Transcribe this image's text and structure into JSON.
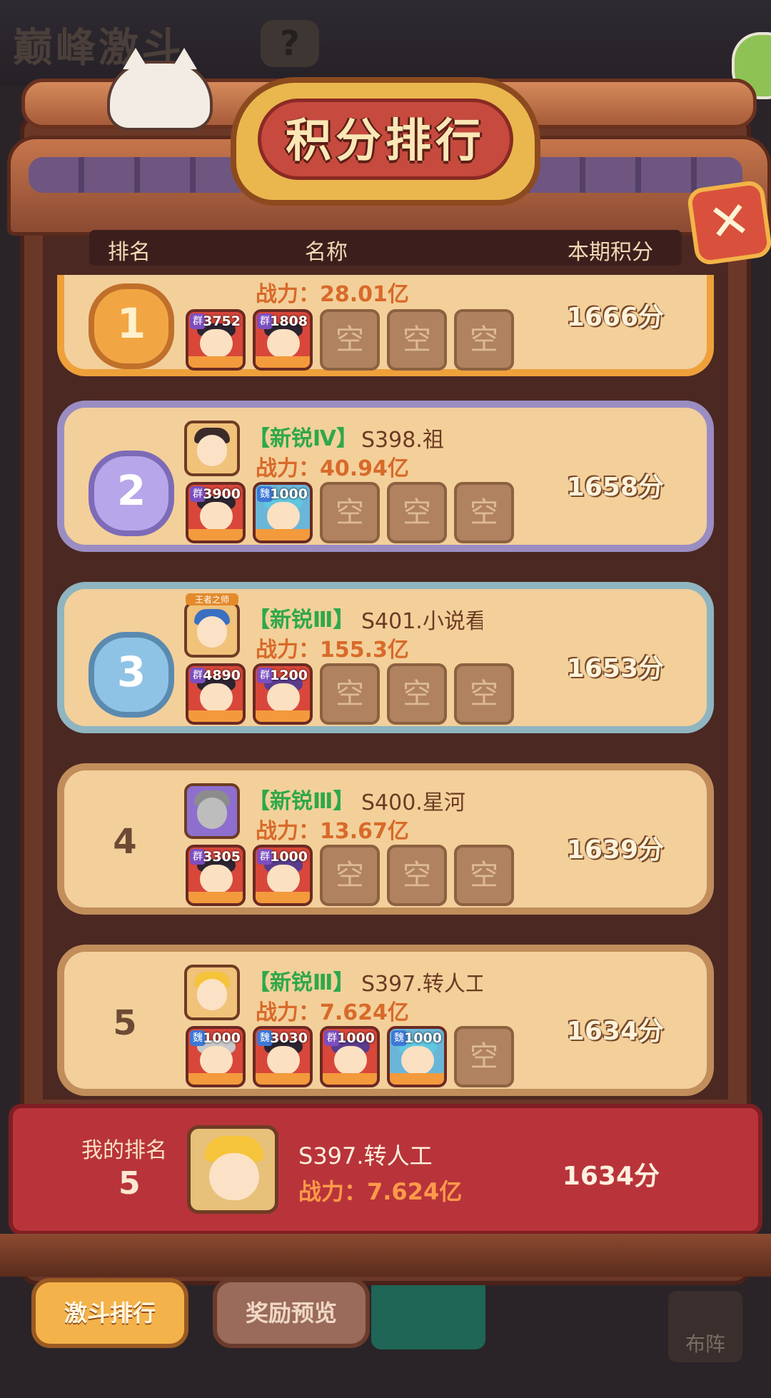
{
  "background": {
    "title": "巅峰激斗",
    "help_glyph": "?",
    "side_button_label": "布阵"
  },
  "panel": {
    "title": "积分排行",
    "close_glyph": "✕"
  },
  "header": {
    "rank": "排名",
    "name": "名称",
    "score": "本期积分"
  },
  "rows": [
    {
      "rank": "1",
      "tag": "",
      "name": "",
      "power": "战力：28.01亿",
      "score": "1666分",
      "slots": [
        {
          "type": "hero",
          "faction": "群",
          "level": "3752"
        },
        {
          "type": "hero",
          "faction": "群",
          "level": "1808"
        },
        {
          "type": "empty",
          "label": "空"
        },
        {
          "type": "empty",
          "label": "空"
        },
        {
          "type": "empty",
          "label": "空"
        }
      ]
    },
    {
      "rank": "2",
      "tag": "【新锐Ⅳ】",
      "name": "S398.祖",
      "power": "战力：40.94亿",
      "score": "1658分",
      "slots": [
        {
          "type": "hero",
          "faction": "群",
          "level": "3900"
        },
        {
          "type": "hero",
          "faction": "魏",
          "level": "1000"
        },
        {
          "type": "empty",
          "label": "空"
        },
        {
          "type": "empty",
          "label": "空"
        },
        {
          "type": "empty",
          "label": "空"
        }
      ]
    },
    {
      "rank": "3",
      "tag": "【新锐Ⅲ】",
      "name": "S401.小说看",
      "power": "战力：155.3亿",
      "score": "1653分",
      "avatar_badge": "王者之师",
      "slots": [
        {
          "type": "hero",
          "faction": "群",
          "level": "4890"
        },
        {
          "type": "hero",
          "faction": "群",
          "level": "1200"
        },
        {
          "type": "empty",
          "label": "空"
        },
        {
          "type": "empty",
          "label": "空"
        },
        {
          "type": "empty",
          "label": "空"
        }
      ]
    },
    {
      "rank": "4",
      "tag": "【新锐Ⅲ】",
      "name": "S400.星河",
      "power": "战力：13.67亿",
      "score": "1639分",
      "slots": [
        {
          "type": "hero",
          "faction": "群",
          "level": "3305"
        },
        {
          "type": "hero",
          "faction": "群",
          "level": "1000"
        },
        {
          "type": "empty",
          "label": "空"
        },
        {
          "type": "empty",
          "label": "空"
        },
        {
          "type": "empty",
          "label": "空"
        }
      ]
    },
    {
      "rank": "5",
      "tag": "【新锐Ⅲ】",
      "name": "S397.转人工",
      "power": "战力：7.624亿",
      "score": "1634分",
      "slots": [
        {
          "type": "hero",
          "faction": "魏",
          "level": "1000"
        },
        {
          "type": "hero",
          "faction": "魏",
          "level": "3030"
        },
        {
          "type": "hero",
          "faction": "群",
          "level": "1000"
        },
        {
          "type": "hero",
          "faction": "魏",
          "level": "1000"
        },
        {
          "type": "empty",
          "label": "空"
        }
      ]
    }
  ],
  "my_rank": {
    "label": "我的排名",
    "rank": "5",
    "name": "S397.转人工",
    "power": "战力：7.624亿",
    "score": "1634分"
  },
  "tabs": {
    "ranking": "激斗排行",
    "rewards": "奖励预览"
  },
  "colors": {
    "tag_green": "#2ea84a",
    "power_orange": "#d86a2a",
    "my_bar_red": "#b8343a"
  }
}
